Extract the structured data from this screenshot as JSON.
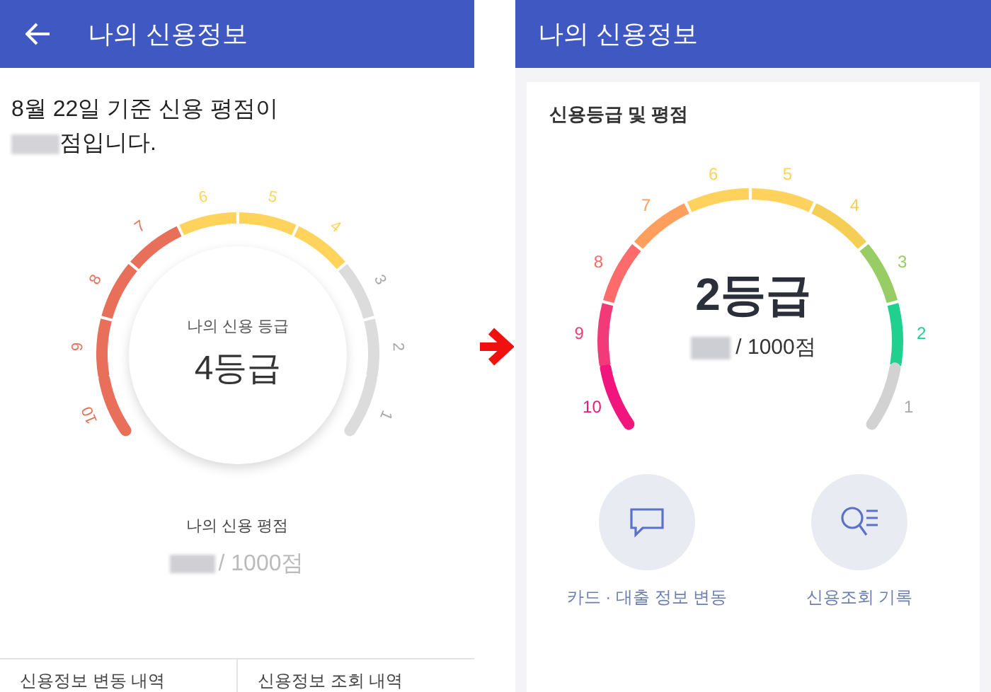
{
  "left_screen": {
    "title": "나의 신용정보",
    "summary_line1": "8월 22일 기준 신용 평점이",
    "summary_line2": "점입니다.",
    "gauge": {
      "grades": [
        {
          "label": "10",
          "color": "#e8705a"
        },
        {
          "label": "9",
          "color": "#e8705a"
        },
        {
          "label": "8",
          "color": "#e8705a"
        },
        {
          "label": "7",
          "color": "#e8705a"
        },
        {
          "label": "6",
          "color": "#ffd35c"
        },
        {
          "label": "5",
          "color": "#ffd35c"
        },
        {
          "label": "4",
          "color": "#ffd35c"
        },
        {
          "label": "3",
          "color": "#dcdcdc"
        },
        {
          "label": "2",
          "color": "#dcdcdc"
        },
        {
          "label": "1",
          "color": "#dcdcdc"
        }
      ],
      "caption": "나의 신용 등급",
      "grade": "4등급"
    },
    "score_label": "나의 신용 평점",
    "score_suffix": "/ 1000점",
    "tabs": [
      {
        "label": "신용정보 변동 내역"
      },
      {
        "label": "신용정보 조회 내역"
      }
    ]
  },
  "right_screen": {
    "title": "나의 신용정보",
    "card_title": "신용등급 및 평점",
    "gauge": {
      "grades": [
        {
          "label": "10",
          "color": "#f0167e"
        },
        {
          "label": "9",
          "color": "#f23a78"
        },
        {
          "label": "8",
          "color": "#ff6a6a"
        },
        {
          "label": "7",
          "color": "#ff9f5e"
        },
        {
          "label": "6",
          "color": "#ffd25e"
        },
        {
          "label": "5",
          "color": "#ffd25e"
        },
        {
          "label": "4",
          "color": "#f5cf55"
        },
        {
          "label": "3",
          "color": "#98cc64"
        },
        {
          "label": "2",
          "color": "#1fd08e"
        },
        {
          "label": "1",
          "color": "#d2d2d2"
        }
      ],
      "grade": "2등급"
    },
    "score_suffix": "/ 1000점",
    "actions": [
      {
        "label": "카드 · 대출 정보 변동",
        "kind": "chat"
      },
      {
        "label": "신용조회 기록",
        "kind": "search-list"
      }
    ]
  }
}
